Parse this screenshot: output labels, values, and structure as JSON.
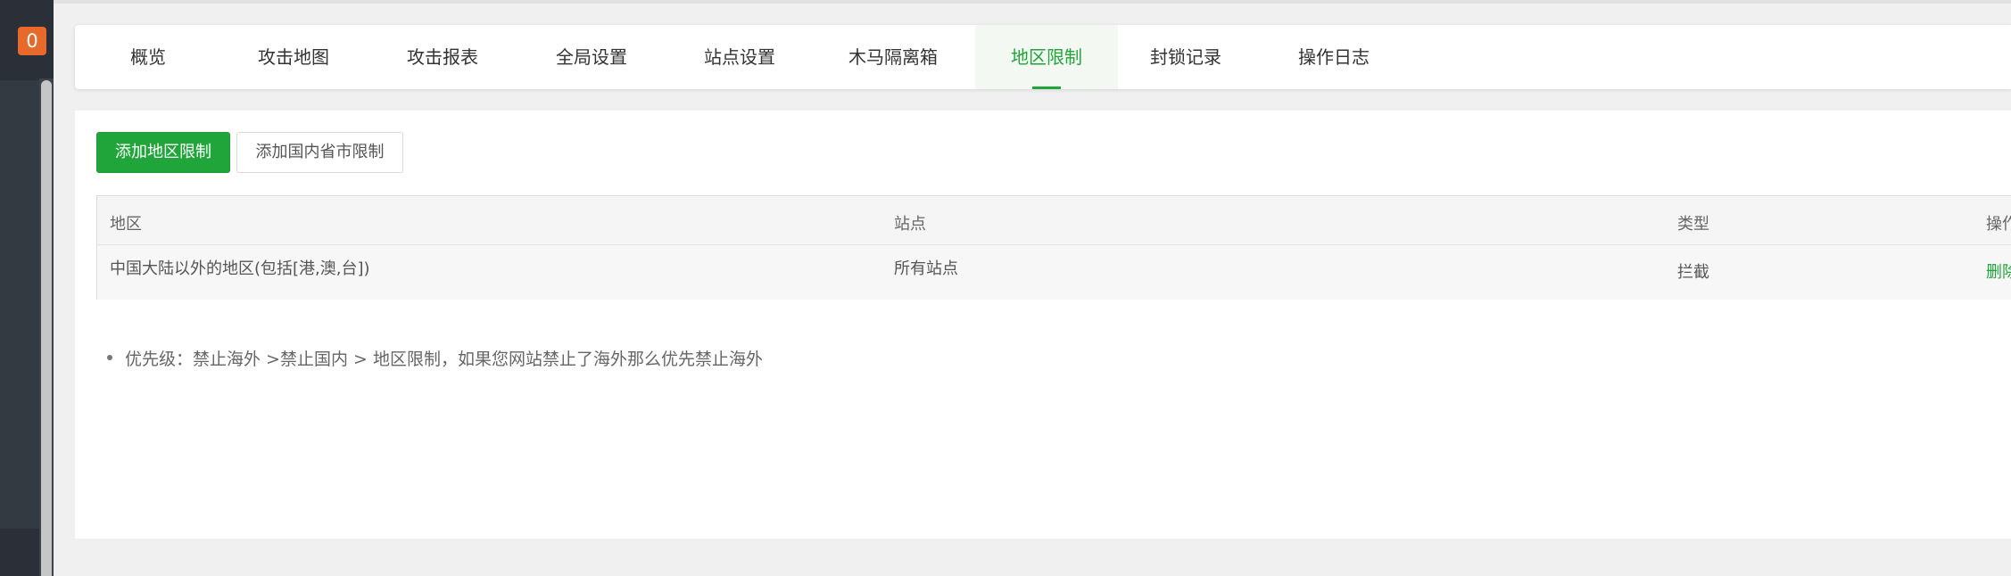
{
  "sidebar": {
    "badge_count": "0"
  },
  "tabs": [
    {
      "label": "概览"
    },
    {
      "label": "攻击地图"
    },
    {
      "label": "攻击报表"
    },
    {
      "label": "全局设置"
    },
    {
      "label": "站点设置"
    },
    {
      "label": "木马隔离箱"
    },
    {
      "label": "地区限制"
    },
    {
      "label": "封锁记录"
    },
    {
      "label": "操作日志"
    }
  ],
  "active_tab": "地区限制",
  "toolbar": {
    "add_region_label": "添加地区限制",
    "add_province_label": "添加国内省市限制"
  },
  "table": {
    "headers": [
      "地区",
      "站点",
      "类型",
      "操作"
    ],
    "rows": [
      [
        "中国大陆以外的地区(包括[港,澳,台])",
        "所有站点",
        "拦截",
        "删除"
      ]
    ]
  },
  "notes": [
    "优先级：禁止海外 >禁止国内 > 地区限制，如果您网站禁止了海外那么优先禁止海外"
  ],
  "colors": {
    "accent": "#20a53a",
    "badge": "#e8692c",
    "sidebar": "#343a42"
  }
}
